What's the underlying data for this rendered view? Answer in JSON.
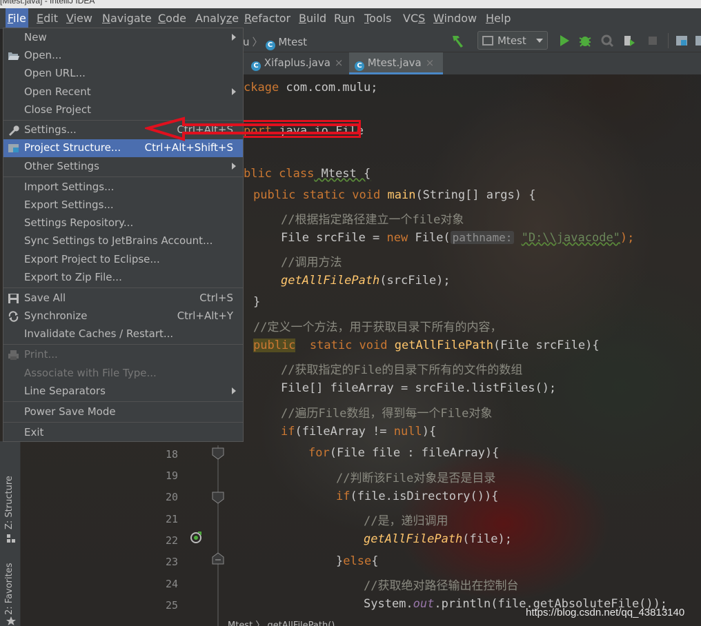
{
  "title_fragment": "[Mtest.java] - IntelliJ IDEA",
  "menubar": {
    "items": [
      {
        "pre": "",
        "u": "F",
        "post": "ile"
      },
      {
        "pre": "",
        "u": "E",
        "post": "dit"
      },
      {
        "pre": "",
        "u": "V",
        "post": "iew"
      },
      {
        "pre": "",
        "u": "N",
        "post": "avigate"
      },
      {
        "pre": "",
        "u": "C",
        "post": "ode"
      },
      {
        "pre": "Analy",
        "u": "z",
        "post": "e"
      },
      {
        "pre": "",
        "u": "R",
        "post": "efactor"
      },
      {
        "pre": "",
        "u": "B",
        "post": "uild"
      },
      {
        "pre": "R",
        "u": "u",
        "post": "n"
      },
      {
        "pre": "",
        "u": "T",
        "post": "ools"
      },
      {
        "pre": "VC",
        "u": "S",
        "post": ""
      },
      {
        "pre": "",
        "u": "W",
        "post": "indow"
      },
      {
        "pre": "",
        "u": "H",
        "post": "elp"
      }
    ]
  },
  "breadcrumb": {
    "part1": "u",
    "sep": "〉",
    "part2": "Mtest"
  },
  "run_config": {
    "label": "Mtest"
  },
  "tabs": [
    {
      "label": "Xifaplus.java",
      "close": "×"
    },
    {
      "label": "Mtest.java",
      "close": "×"
    }
  ],
  "file_menu": {
    "items": [
      {
        "label": "New"
      },
      {
        "label": "Open..."
      },
      {
        "label": "Open URL..."
      },
      {
        "label": "Open Recent"
      },
      {
        "label": "Close Project"
      },
      {
        "label": "Settings...",
        "shortcut": "Ctrl+Alt+S"
      },
      {
        "label": "Project Structure...",
        "shortcut": "Ctrl+Alt+Shift+S"
      },
      {
        "label": "Other Settings"
      },
      {
        "label": "Import Settings..."
      },
      {
        "label": "Export Settings..."
      },
      {
        "label": "Settings Repository..."
      },
      {
        "label": "Sync Settings to JetBrains Account..."
      },
      {
        "label": "Export Project to Eclipse..."
      },
      {
        "label": "Export to Zip File..."
      },
      {
        "label": "Save All",
        "shortcut": "Ctrl+S"
      },
      {
        "label": "Synchronize",
        "shortcut": "Ctrl+Alt+Y"
      },
      {
        "label": "Invalidate Caches / Restart..."
      },
      {
        "label": "Print..."
      },
      {
        "label": "Associate with File Type..."
      },
      {
        "label": "Line Separators"
      },
      {
        "label": "Power Save Mode"
      },
      {
        "label": "Exit"
      }
    ]
  },
  "code": {
    "l1": [
      "ckage",
      " com.com.mulu;"
    ],
    "l2": [
      "port",
      " java.io.File"
    ],
    "l3": [
      "blic class",
      " Mtest {"
    ],
    "l4": [
      "public static void",
      " ",
      "main",
      "(String[] args) {"
    ],
    "l5": "//根据指定路径建立一个file对象",
    "l6": [
      "File srcFile = ",
      "new",
      " File(",
      "pathname:",
      " ",
      "\"D:\\\\javacode\"",
      ");"
    ],
    "l7": "//调用方法",
    "l8": [
      "getAllFilePath",
      "(srcFile);"
    ],
    "l9": "}",
    "l10": "//定义一个方法，用于获取目录下所有的内容，",
    "l11": [
      "public",
      "  static void",
      " ",
      "getAllFilePath",
      "(File srcFile){"
    ],
    "l12": "//获取指定的File的目录下所有的文件的数组",
    "l13": "File[] fileArray = srcFile.listFiles();",
    "l14": "//遍历File数组，得到每一个File对象",
    "l15": [
      "if",
      "(fileArray != ",
      "null",
      "){"
    ],
    "l16": [
      "for",
      "(File file : fileArray){"
    ],
    "l17": "//判断该File对象是否是目录",
    "l18": [
      "if",
      "(file.isDirectory()){"
    ],
    "l19": "//是，递归调用",
    "l20": [
      "getAllFilePath",
      "(file);"
    ],
    "l21": [
      "}",
      "else",
      "{"
    ],
    "l22": "//获取绝对路径输出在控制台",
    "l23": [
      "System.",
      "out",
      ".println(file.getAbsoluteFile());"
    ]
  },
  "line_numbers": [
    "18",
    "19",
    "20",
    "21",
    "22",
    "23",
    "24",
    "25"
  ],
  "left_toolwindows": {
    "structure": "Z: Structure",
    "favorites": "2: Favorites"
  },
  "bottom_crumb": "Mtest 〉 getAllFilePath()",
  "watermark": "https://blog.csdn.net/qq_43813140",
  "colors": {
    "menu_bg": "#3c3f41",
    "selection": "#4b6eaf",
    "annotation": "#e0101e"
  }
}
